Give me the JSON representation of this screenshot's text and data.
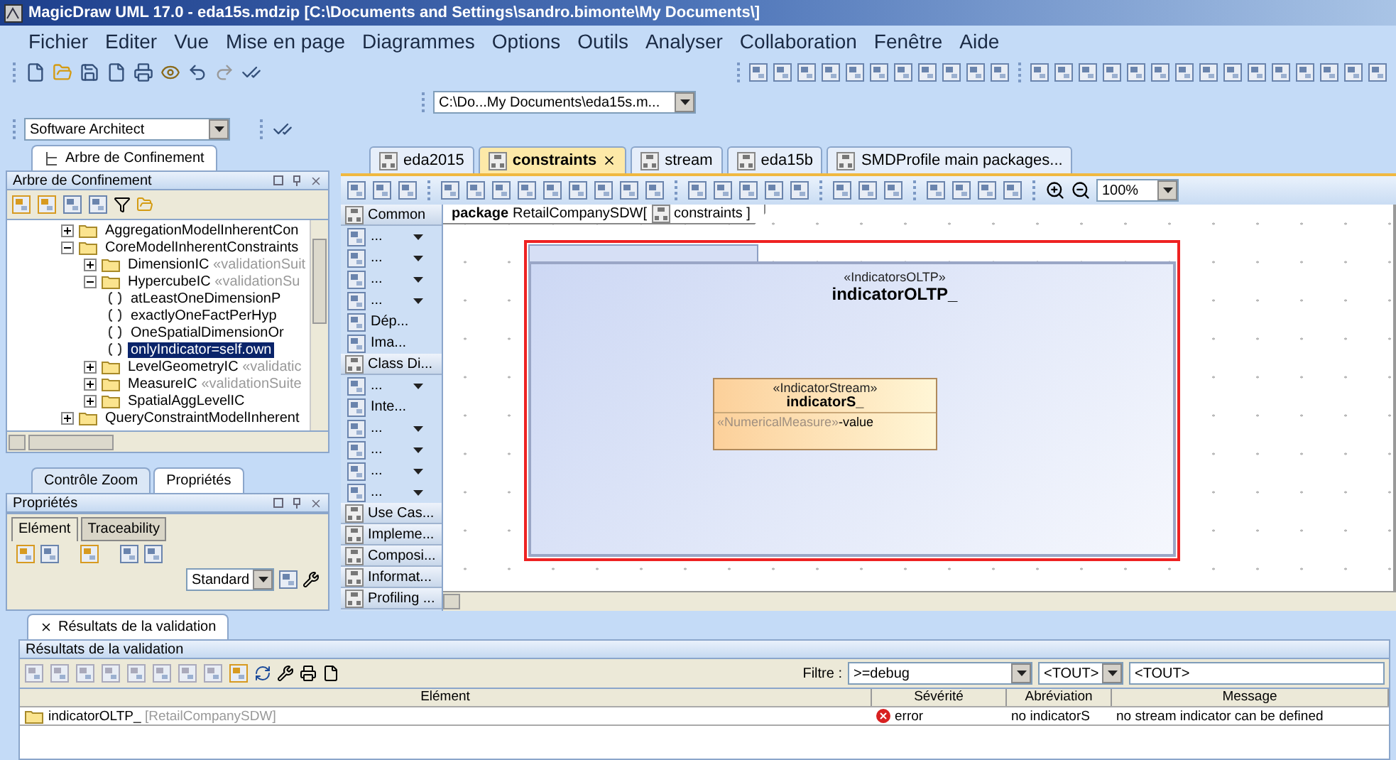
{
  "window": {
    "title": "MagicDraw UML 17.0 - eda15s.mdzip [C:\\Documents and Settings\\sandro.bimonte\\My Documents\\]"
  },
  "menu": [
    "Fichier",
    "Editer",
    "Vue",
    "Mise en page",
    "Diagrammes",
    "Options",
    "Outils",
    "Analyser",
    "Collaboration",
    "Fenêtre",
    "Aide"
  ],
  "project_path": "C:\\Do...My Documents\\eda15s.m...",
  "perspective": "Software Architect",
  "containment": {
    "tab": {
      "label": "Arbre de Confinement",
      "selected": true
    },
    "title": "Arbre de Confinement",
    "tree": [
      {
        "kind": "folder",
        "label": "AggregationModelInherentCon",
        "expanded": false,
        "selected": false
      },
      {
        "kind": "folder",
        "label": "CoreModelInherentConstraints",
        "expanded": true,
        "selected": false,
        "children": [
          {
            "kind": "folder",
            "label": "DimensionIC",
            "stereotype": "«validationSuit",
            "expanded": false,
            "selected": false
          },
          {
            "kind": "folder",
            "label": "HypercubeIC",
            "stereotype": "«validationSu",
            "expanded": true,
            "selected": false,
            "children": [
              {
                "kind": "constraint",
                "label": "atLeastOneDimensionP",
                "selected": false
              },
              {
                "kind": "constraint",
                "label": "exactlyOneFactPerHyp",
                "selected": false
              },
              {
                "kind": "constraint",
                "label": "OneSpatialDimensionOr",
                "selected": false
              },
              {
                "kind": "constraint",
                "label": "onlyIndicator=self.own",
                "selected": true
              }
            ]
          },
          {
            "kind": "folder",
            "label": "LevelGeometryIC",
            "stereotype": "«validatic",
            "expanded": false,
            "selected": false
          },
          {
            "kind": "folder",
            "label": "MeasureIC",
            "stereotype": "«validationSuite",
            "expanded": false,
            "selected": false
          },
          {
            "kind": "folder",
            "label": "SpatialAggLevelIC",
            "expanded": false,
            "selected": false
          }
        ]
      },
      {
        "kind": "folder",
        "label": "QueryConstraintModelInherent",
        "expanded": false,
        "selected": false
      }
    ]
  },
  "lower_tabs": [
    {
      "label": "Contrôle Zoom",
      "selected": false
    },
    {
      "label": "Propriétés",
      "selected": true
    }
  ],
  "properties": {
    "title": "Propriétés",
    "tabs": [
      {
        "label": "Elément",
        "selected": true
      },
      {
        "label": "Traceability",
        "selected": false
      }
    ],
    "mode": "Standard"
  },
  "editor_tabs": [
    {
      "label": "eda2015",
      "selected": false
    },
    {
      "label": "constraints",
      "selected": true
    },
    {
      "label": "stream",
      "selected": false
    },
    {
      "label": "eda15b",
      "selected": false
    },
    {
      "label": "SMDProfile main packages...",
      "selected": false
    }
  ],
  "zoom": "100%",
  "palette": [
    {
      "kind": "section",
      "label": "Common"
    },
    {
      "kind": "tool",
      "label": "...",
      "has_menu": true
    },
    {
      "kind": "tool",
      "label": "...",
      "has_menu": true
    },
    {
      "kind": "tool",
      "label": "...",
      "has_menu": true
    },
    {
      "kind": "tool",
      "label": "...",
      "has_menu": true
    },
    {
      "kind": "tool",
      "label": "Dép...",
      "has_menu": false
    },
    {
      "kind": "tool",
      "label": "Ima...",
      "has_menu": false
    },
    {
      "kind": "section",
      "label": "Class Di..."
    },
    {
      "kind": "tool",
      "label": "...",
      "has_menu": true
    },
    {
      "kind": "tool",
      "label": "Inte...",
      "has_menu": false
    },
    {
      "kind": "tool",
      "label": "...",
      "has_menu": true
    },
    {
      "kind": "tool",
      "label": "...",
      "has_menu": true
    },
    {
      "kind": "tool",
      "label": "...",
      "has_menu": true
    },
    {
      "kind": "tool",
      "label": "...",
      "has_menu": true
    },
    {
      "kind": "section",
      "label": "Use Cas..."
    },
    {
      "kind": "section",
      "label": "Impleme..."
    },
    {
      "kind": "section",
      "label": "Composi..."
    },
    {
      "kind": "section",
      "label": "Informat..."
    },
    {
      "kind": "section",
      "label": "Profiling ..."
    }
  ],
  "diagram": {
    "frame_kind": "package",
    "frame_name": "RetailCompanySDW[",
    "frame_diagram": "constraints ]",
    "package": {
      "stereotype": "«IndicatorsOLTP»",
      "name": "indicatorOLTP_",
      "selected": true
    },
    "class": {
      "stereotype": "«IndicatorStream»",
      "name": "indicatorS_",
      "attribute_stereotype": "«NumericalMeasure»",
      "attribute_name": "-value"
    }
  },
  "validation": {
    "tab": "Résultats de la validation",
    "title": "Résultats de la validation",
    "filter_label": "Filtre :",
    "filter_severity": ">=debug",
    "filter_2": "<TOUT>",
    "filter_3": "<TOUT>",
    "columns": [
      "Elément",
      "Sévérité",
      "Abréviation",
      "Message"
    ],
    "rows": [
      {
        "element": "indicatorOLTP_",
        "owner": "[RetailCompanySDW]",
        "severity": "error",
        "abbreviation": "no indicatorS",
        "message": "no stream indicator can be defined"
      }
    ]
  }
}
